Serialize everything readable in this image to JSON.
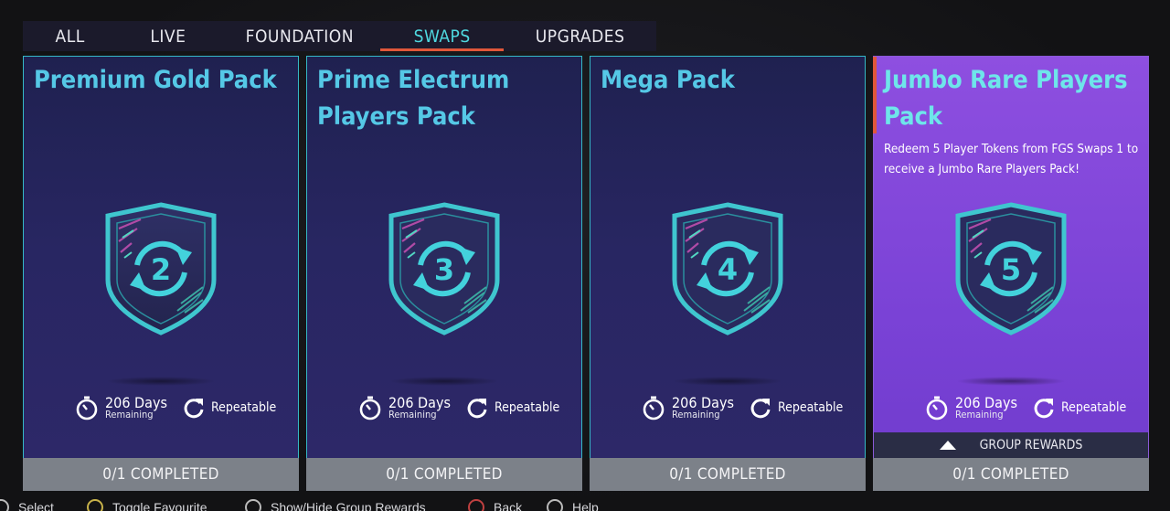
{
  "tabs": [
    {
      "label": "ALL",
      "active": false
    },
    {
      "label": "LIVE",
      "active": false
    },
    {
      "label": "FOUNDATION",
      "active": false
    },
    {
      "label": "SWAPS",
      "active": true
    },
    {
      "label": "UPGRADES",
      "active": false
    }
  ],
  "cards": [
    {
      "title": "Premium Gold Pack",
      "description": "",
      "badge_number": "2",
      "days": "206 Days",
      "remaining": "Remaining",
      "repeatable": "Repeatable",
      "progress": "0/1 COMPLETED"
    },
    {
      "title": "Prime Electrum Players Pack",
      "description": "",
      "badge_number": "3",
      "days": "206 Days",
      "remaining": "Remaining",
      "repeatable": "Repeatable",
      "progress": "0/1 COMPLETED"
    },
    {
      "title": "Mega Pack",
      "description": "",
      "badge_number": "4",
      "days": "206 Days",
      "remaining": "Remaining",
      "repeatable": "Repeatable",
      "progress": "0/1 COMPLETED"
    },
    {
      "title": "Jumbo Rare Players Pack",
      "description": "Redeem 5 Player Tokens from FGS Swaps 1 to receive a Jumbo Rare Players Pack!",
      "badge_number": "5",
      "days": "206 Days",
      "remaining": "Remaining",
      "repeatable": "Repeatable",
      "progress": "0/1 COMPLETED",
      "group_rewards": "GROUP REWARDS",
      "selected": true
    }
  ],
  "footer": {
    "hints": [
      "Select",
      "Toggle Favourite",
      "Show/Hide Group Rewards",
      "Back",
      "Help"
    ]
  },
  "colors": {
    "accent": "#4fd9e0",
    "tab_underline": "#e0573a",
    "card_bg": "#282662",
    "card_selected_bg": "#7a42d6",
    "progress_bar": "#7c8189"
  },
  "icons": {
    "timer": "stopwatch-icon",
    "repeat": "repeat-icon",
    "badge": "swap-shield-icon",
    "expand": "triangle-up-icon"
  }
}
